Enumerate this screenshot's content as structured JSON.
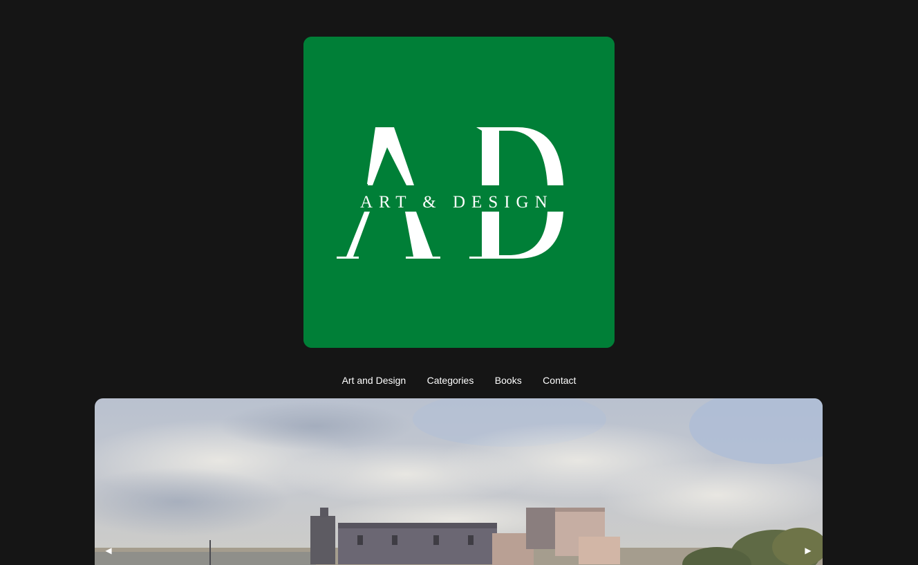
{
  "brand": {
    "logo_text": "AD ART & DESIGN",
    "background_color": "#007f37",
    "text_color": "#ffffff"
  },
  "nav": {
    "items": [
      {
        "label": "Art and Design"
      },
      {
        "label": "Categories"
      },
      {
        "label": "Books"
      },
      {
        "label": "Contact"
      }
    ]
  },
  "slider": {
    "prev_icon": "triangle-left-icon",
    "next_icon": "triangle-right-icon",
    "prev_glyph": "◀",
    "next_glyph": "▶"
  },
  "page": {
    "background_color": "#151515"
  }
}
